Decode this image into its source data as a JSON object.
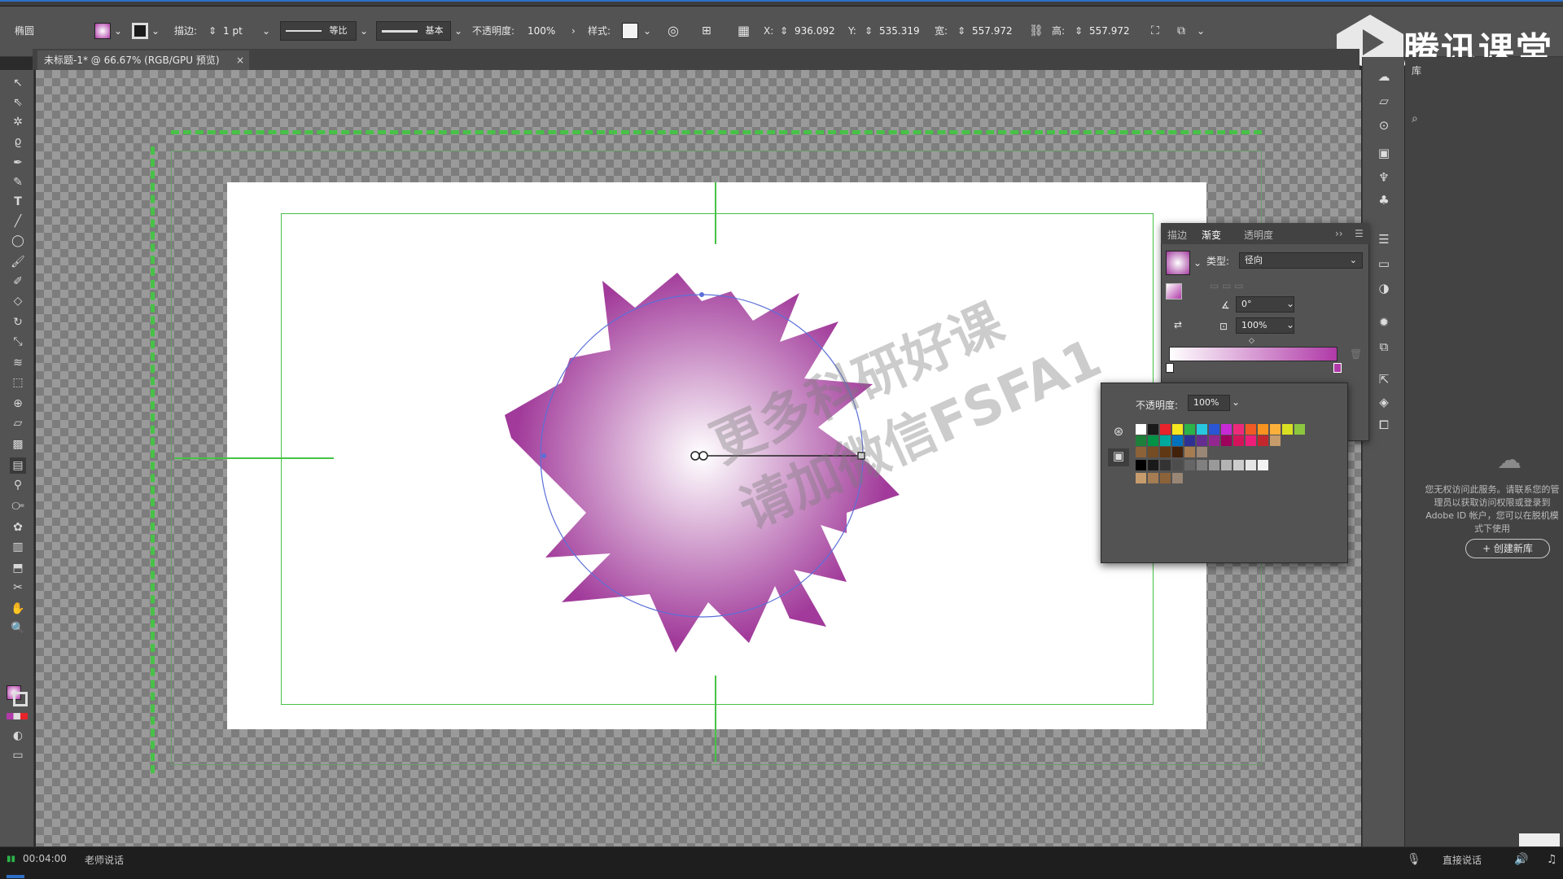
{
  "window": {
    "doc_tab_title": "未标题-1* @ 66.67% (RGB/GPU 预览)",
    "doc_tab_close": "×",
    "tencent_brand": "腾讯课堂"
  },
  "control_bar": {
    "object_label": "椭圆",
    "stroke_label": "描边:",
    "stroke_weight": "1 pt",
    "stroke_profile": "等比",
    "brush": "基本",
    "opacity_label": "不透明度:",
    "opacity_value": "100%",
    "style_label": "样式:",
    "x_label": "X:",
    "x_value": "936.092",
    "y_label": "Y:",
    "y_value": "535.319",
    "w_label": "宽:",
    "w_value": "557.972",
    "h_label": "高:",
    "h_value": "557.972"
  },
  "gradient_panel": {
    "tabs": [
      "描边",
      "渐变",
      "透明度"
    ],
    "type_label": "类型:",
    "type_value": "径向",
    "angle_value": "0°",
    "aspect_value": "100%",
    "colors": {
      "start": "#ffffff",
      "end": "#b03aa8"
    }
  },
  "swatch_popup": {
    "opacity_label": "不透明度:",
    "opacity_value": "100%",
    "row1": [
      "#ffffff",
      "#1a1a1a",
      "#e8232a",
      "#f5e61e",
      "#2bb34a",
      "#27c7e0",
      "#2a55d4",
      "#c72ad4",
      "#ee2a7b",
      "#f15a24",
      "#f7931e",
      "#fbb03b",
      "#d9e021",
      "#8cc63f"
    ],
    "row2": [
      "#1e7f3a",
      "#009245",
      "#00a99d",
      "#0071bc",
      "#2e3192",
      "#662d91",
      "#93278f",
      "#9e005d",
      "#d4145a",
      "#ed1e79",
      "#c1272d",
      "#c69c6d"
    ],
    "row3": [
      "#8c6239",
      "#754c24",
      "#603813",
      "#42210b",
      "#a67c52",
      "#998675"
    ],
    "row4": [
      "#000000",
      "#1a1a1a",
      "#333333",
      "#4d4d4d",
      "#666666",
      "#808080",
      "#999999",
      "#b3b3b3",
      "#cccccc",
      "#e6e6e6",
      "#f2f2f2"
    ],
    "row5": [
      "#c69c6d",
      "#a67c52",
      "#8c6239",
      "#998675"
    ]
  },
  "library_panel": {
    "tab_label": "库",
    "message": "您无权访问此服务。请联系您的管理员以获取访问权限或登录到 Adobe ID 帐户，您可以在脱机模式下使用",
    "create_button": "+ 创建新库"
  },
  "bottom_bar": {
    "time": "00:04:00",
    "teacher_label": "老师说话",
    "live_label": "直接说话"
  },
  "watermark": {
    "line1": "更多科研好课",
    "line2": "请加微信FSFA1"
  }
}
